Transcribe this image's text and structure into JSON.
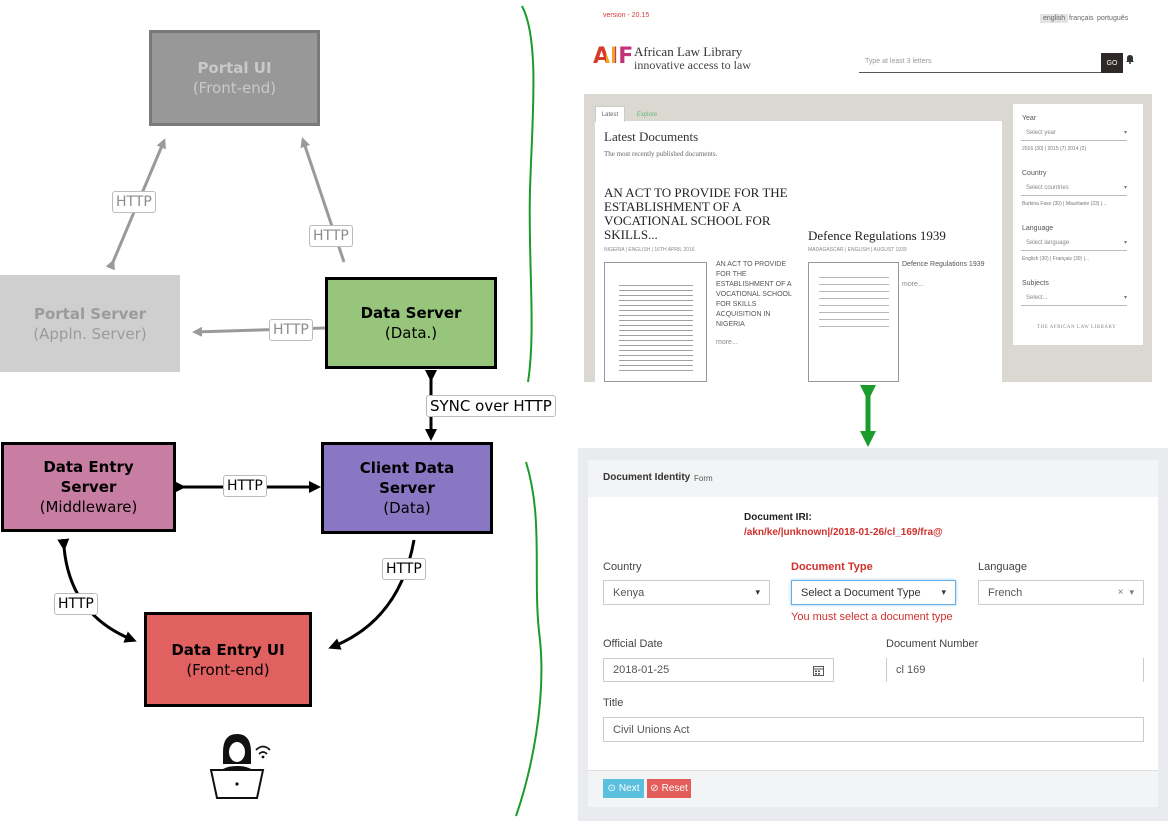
{
  "diagram": {
    "nodes": {
      "portal_ui": {
        "line1": "Portal UI",
        "line2": "(Front-end)",
        "fill": "#989898"
      },
      "portal_server": {
        "line1": "Portal Server",
        "line2": "(Appln. Server)",
        "fill": "#cfcfcf"
      },
      "data_server": {
        "line1": "Data Server",
        "line2": "(Data.)",
        "fill": "#97c57c"
      },
      "data_entry_server": {
        "line1": "Data Entry",
        "line2": "Server",
        "line3": "(Middleware)",
        "fill": "#c87ea3"
      },
      "client_data_server": {
        "line1": "Client Data",
        "line2": "Server",
        "line3": "(Data)",
        "fill": "#8a77c4"
      },
      "data_entry_ui": {
        "line1": "Data Entry UI",
        "line2": "(Front-end)",
        "fill": "#e0615f"
      }
    },
    "edge_labels": {
      "portal_http": "HTTP",
      "dataserver_portalui_http": "HTTP",
      "dataserver_portalserver_http": "HTTP",
      "sync": "SYNC over HTTP",
      "middleware_http": "HTTP",
      "client_ui_http": "HTTP",
      "entry_ui_http": "HTTP"
    },
    "accent_green": "#1a9c2c"
  },
  "portal_screenshot": {
    "version_text": "version - 20.15",
    "languages": [
      "english",
      "français",
      "português"
    ],
    "logo_mark": "AIF",
    "logo_line1": "African Law Library",
    "logo_line2": "innovative access to law",
    "search_placeholder": "Type at least 3 letters",
    "go_label": "GO",
    "tabs": [
      "Latest",
      "Explore"
    ],
    "section_title": "Latest Documents",
    "section_subtitle": "The most recently published documents.",
    "doc1": {
      "title_lines": [
        "AN ACT TO PROVIDE FOR THE",
        "ESTABLISHMENT OF A",
        "VOCATIONAL SCHOOL FOR",
        "SKILLS..."
      ],
      "meta": "NIGERIA | ENGLISH | 16TH APRIL 2016",
      "desc_lines": [
        "AN ACT TO PROVIDE",
        "FOR THE",
        "ESTABLISHMENT OF A",
        "VOCATIONAL SCHOOL",
        "FOR SKILLS",
        "ACQUISITION IN",
        "NIGERIA"
      ],
      "more": "more..."
    },
    "doc2": {
      "title": "Defence Regulations 1939",
      "meta": "MADAGASCAR | ENGLISH | AUGUST 1939",
      "desc": "Defence Regulations 1939",
      "more": "more..."
    },
    "filters": [
      {
        "label": "Year",
        "select": "Select year",
        "hint": "2016 (30) | 2015 (7) 2014 (2)"
      },
      {
        "label": "Country",
        "select": "Select countries",
        "hint": "Burkina Faso (30) | Mauritanie (23) |..."
      },
      {
        "label": "Language",
        "select": "Select language",
        "hint": "English (30) | Français (30) |..."
      },
      {
        "label": "Subjects",
        "select": "Select...",
        "hint": ""
      }
    ],
    "filter_footer": "THE AFRICAN LAW LIBRARY"
  },
  "form": {
    "header_title": "Document Identity",
    "header_suffix": "Form",
    "iri_label": "Document IRI:",
    "iri_value": "/akn/ke/|unknown|/2018-01-26/cl_169/fra@",
    "country_label": "Country",
    "country_value": "Kenya",
    "doctype_label": "Document Type",
    "doctype_value": "Select a Document Type",
    "doctype_error": "You must select a document type",
    "language_label": "Language",
    "language_value": "French",
    "date_label": "Official Date",
    "date_value": "2018-01-25",
    "number_label": "Document Number",
    "number_value": "cl 169",
    "title_label": "Title",
    "title_value": "Civil Unions Act",
    "next_label": "Next",
    "reset_label": "Reset",
    "error_color": "#d0312d",
    "next_color": "#5bc0de",
    "reset_color": "#e35d5a"
  }
}
